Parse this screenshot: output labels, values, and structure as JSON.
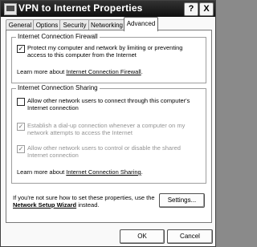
{
  "window": {
    "title": "VPN to Internet Properties",
    "help_label": "?",
    "close_label": "X"
  },
  "tabs": [
    {
      "label": "General"
    },
    {
      "label": "Options"
    },
    {
      "label": "Security"
    },
    {
      "label": "Networking"
    },
    {
      "label": "Advanced",
      "selected": true
    }
  ],
  "firewall": {
    "legend": "Internet Connection Firewall",
    "checkbox": {
      "lines": [
        "Protect my computer and network by limiting or preventing",
        "access to this computer from the Internet"
      ],
      "checked": true,
      "enabled": true
    },
    "learn_prefix": "Learn more about ",
    "learn_link": "Internet Connection Firewall",
    "learn_suffix": "."
  },
  "sharing": {
    "legend": "Internet Connection Sharing",
    "options": [
      {
        "lines": [
          "Allow other network users to connect through this computer's",
          "Internet connection"
        ],
        "checked": false,
        "enabled": true
      },
      {
        "lines": [
          "Establish a dial-up connection whenever a computer on my",
          "network attempts to access the Internet"
        ],
        "checked": true,
        "enabled": false
      },
      {
        "lines": [
          "Allow other network users to control or disable the shared",
          "Internet connection"
        ],
        "checked": true,
        "enabled": false
      }
    ],
    "learn_prefix": "Learn more about ",
    "learn_link": "Internet Connection Sharing",
    "learn_suffix": "."
  },
  "hint": {
    "line1": "If you're not sure how to set these properties, use the",
    "link": "Network Setup Wizard",
    "line2_suffix": " instead."
  },
  "buttons": {
    "settings": "Settings...",
    "ok": "OK",
    "cancel": "Cancel"
  },
  "check_glyph": "✓"
}
